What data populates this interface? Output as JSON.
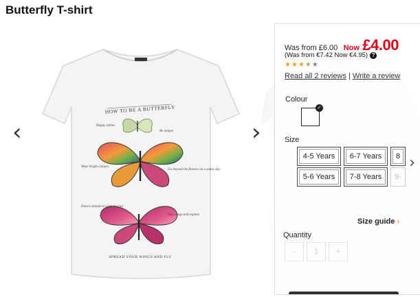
{
  "product": {
    "title": "Butterfly T-shirt"
  },
  "shirt": {
    "print_heading": "HOW TO BE A BUTTERFLY",
    "print_footer": "SPREAD YOUR WINGS AND FLY",
    "notes": [
      "Happy smiles",
      "Be unique",
      "Wear bright colours",
      "Go beyond the flowers on a sunny day",
      "Dance around on your tip toes",
      "Sing songs and explore"
    ]
  },
  "price": {
    "was_text": "Was from £6.00",
    "now_label": "Now",
    "now_price": "£4.00",
    "was_secondary": "(Was from €7.42 Now €4.95)",
    "help_icon": "?"
  },
  "rating": {
    "value": 3.5,
    "max": 5
  },
  "reviews": {
    "read_link": "Read all 2 reviews",
    "separator": "|",
    "write_link": "Write a review"
  },
  "colour": {
    "label": "Colour",
    "selected": "White"
  },
  "size": {
    "label": "Size",
    "options": [
      "4-5 Years",
      "6-7 Years",
      "8",
      "5-6 Years",
      "7-8 Years",
      "9-"
    ]
  },
  "size_guide": {
    "label": "Size guide",
    "chevron": "›"
  },
  "quantity": {
    "label": "Quantity",
    "minus": "-",
    "value": "1",
    "plus": "+"
  },
  "nav": {
    "prev": "‹",
    "next": "›",
    "panel_next": "›"
  },
  "colors": {
    "sale_red": "#d9001b",
    "accent_orange": "#f2a01a"
  }
}
